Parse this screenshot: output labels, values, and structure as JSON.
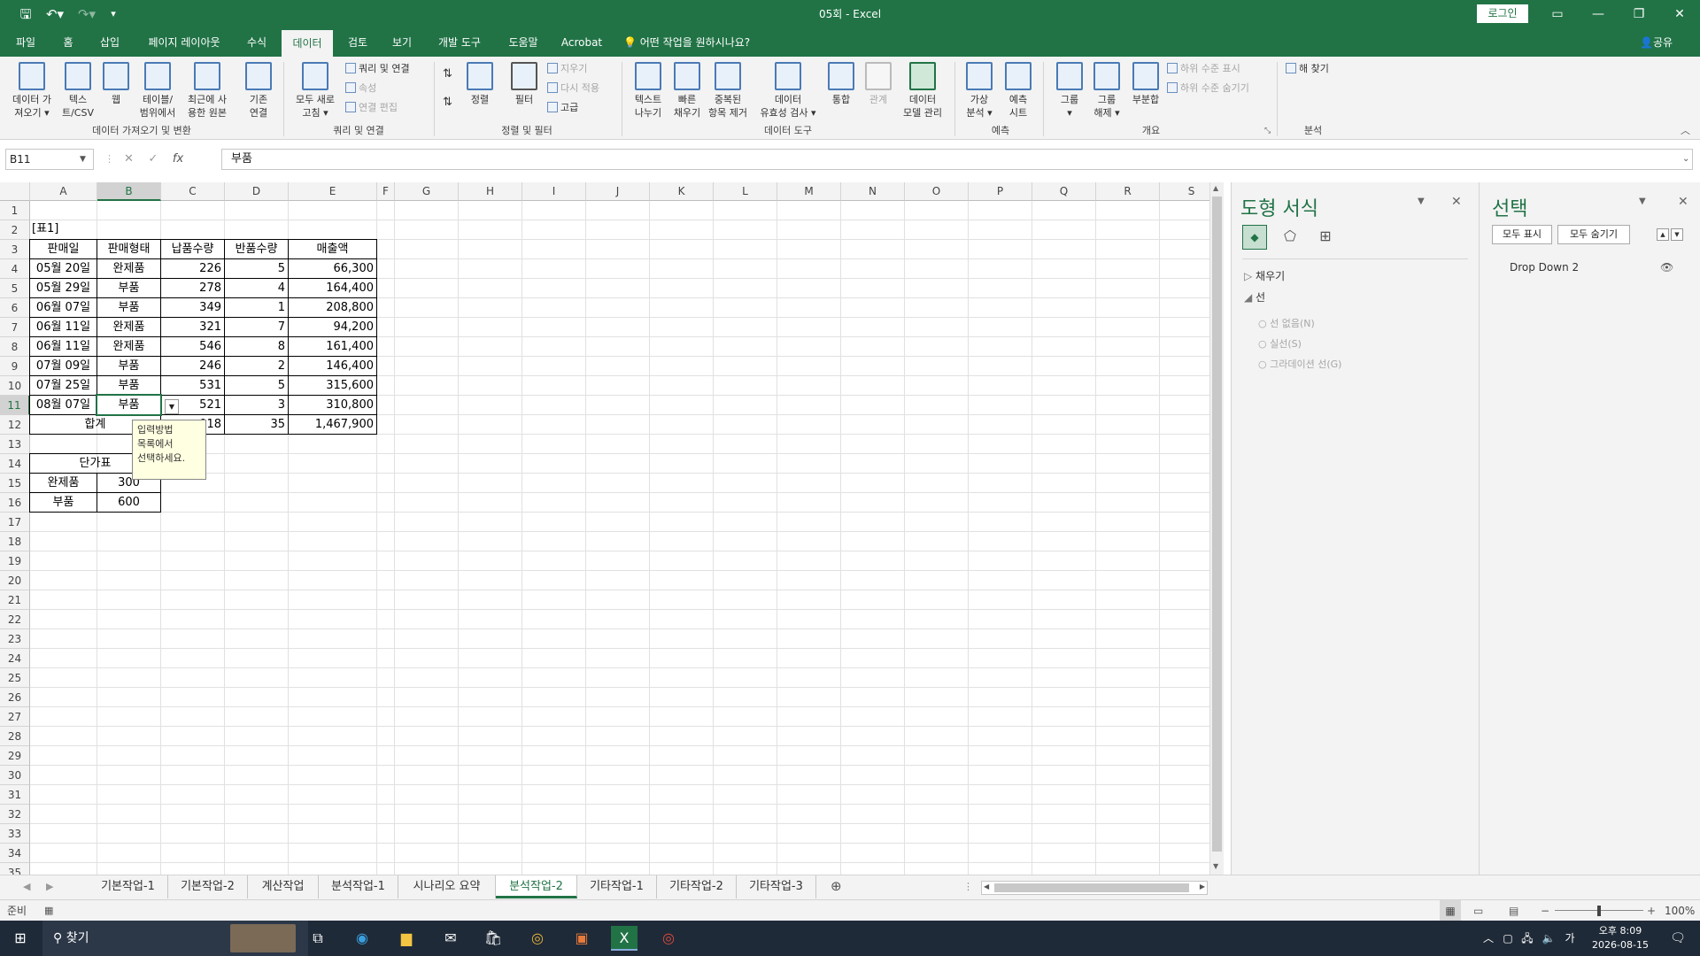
{
  "window": {
    "title": "05회 - Excel",
    "login_label": "로그인",
    "share_label": "공유"
  },
  "ribbon_tabs": [
    "파일",
    "홈",
    "삽입",
    "페이지 레이아웃",
    "수식",
    "데이터",
    "검토",
    "보기",
    "개발 도구",
    "도움말",
    "Acrobat"
  ],
  "active_tab": "데이터",
  "tell_me": "어떤 작업을 원하시나요?",
  "ribbon": {
    "get_data": {
      "line1": "데이터 가",
      "line2": "져오기 ▾"
    },
    "text_csv": {
      "line1": "텍스",
      "line2": "트/CSV"
    },
    "web": {
      "line1": "웹"
    },
    "table_range": {
      "line1": "테이블/",
      "line2": "범위에서"
    },
    "recent_sources": {
      "line1": "최근에 사",
      "line2": "용한 원본"
    },
    "existing": {
      "line1": "기존",
      "line2": "연결"
    },
    "group_get": "데이터 가져오기 및 변환",
    "refresh_all": {
      "line1": "모두 새로",
      "line2": "고침 ▾"
    },
    "queries_connections": "쿼리 및 연결",
    "properties": "속성",
    "edit_links": "연결 편집",
    "group_queries": "쿼리 및 연결",
    "sort": "정렬",
    "filter": "필터",
    "clear": "지우기",
    "reapply": "다시 적용",
    "advanced": "고급",
    "group_sort": "정렬 및 필터",
    "text_to_columns": {
      "line1": "텍스트",
      "line2": "나누기"
    },
    "flash_fill": {
      "line1": "빠른",
      "line2": "채우기"
    },
    "remove_dup": {
      "line1": "중복된",
      "line2": "항목 제거"
    },
    "validation": {
      "line1": "데이터",
      "line2": "유효성 검사 ▾"
    },
    "consolidate": {
      "line1": "통합"
    },
    "relationships": {
      "line1": "관계"
    },
    "data_model": {
      "line1": "데이터",
      "line2": "모델 관리"
    },
    "group_tools": "데이터 도구",
    "what_if": {
      "line1": "가상",
      "line2": "분석 ▾"
    },
    "forecast_sheet": {
      "line1": "예측",
      "line2": "시트"
    },
    "group_forecast": "예측",
    "group_btn": {
      "line1": "그룹",
      "line2": "▾"
    },
    "ungroup": {
      "line1": "그룹",
      "line2": "해제 ▾"
    },
    "subtotal": {
      "line1": "부분합"
    },
    "show_detail": "하위 수준 표시",
    "hide_detail": "하위 수준 숨기기",
    "group_outline": "개요",
    "solver": "해 찾기",
    "group_analysis": "분석"
  },
  "formula_bar": {
    "name_box": "B11",
    "formula": "부품"
  },
  "columns": [
    "A",
    "B",
    "C",
    "D",
    "E",
    "F",
    "G",
    "H",
    "I",
    "J",
    "K",
    "L",
    "M",
    "N",
    "O",
    "P",
    "Q",
    "R",
    "S"
  ],
  "rows": [
    "1",
    "2",
    "3",
    "4",
    "5",
    "6",
    "7",
    "8",
    "9",
    "10",
    "11",
    "12",
    "13",
    "14",
    "15",
    "16",
    "17",
    "18",
    "19",
    "20",
    "21",
    "22",
    "23",
    "24",
    "25",
    "26",
    "27",
    "28",
    "29",
    "30",
    "31",
    "32",
    "33",
    "34",
    "35"
  ],
  "sheet": {
    "table_label": "[표1]",
    "headers": [
      "판매일",
      "판매형태",
      "납품수량",
      "반품수량",
      "매출액"
    ],
    "data": [
      [
        "05월 20일",
        "완제품",
        "226",
        "5",
        "66,300"
      ],
      [
        "05월 29일",
        "부품",
        "278",
        "4",
        "164,400"
      ],
      [
        "06월 07일",
        "부품",
        "349",
        "1",
        "208,800"
      ],
      [
        "06월 11일",
        "완제품",
        "321",
        "7",
        "94,200"
      ],
      [
        "06월 11일",
        "완제품",
        "546",
        "8",
        "161,400"
      ],
      [
        "07월 09일",
        "부품",
        "246",
        "2",
        "146,400"
      ],
      [
        "07월 25일",
        "부품",
        "531",
        "5",
        "315,600"
      ],
      [
        "08월 07일",
        "부품",
        "521",
        "3",
        "310,800"
      ]
    ],
    "total_label": "합계",
    "total_c": "018",
    "total_d": "35",
    "total_e": "1,467,900",
    "price_title": "단가표",
    "price_rows": [
      [
        "완제품",
        "300"
      ],
      [
        "부품",
        "600"
      ]
    ]
  },
  "tooltip": {
    "line1": "입력방법",
    "line2": "목록에서",
    "line3": "선택하세요."
  },
  "format_pane": {
    "title": "도형 서식",
    "fill_label": "채우기",
    "line_label": "선",
    "options": [
      "선 없음(N)",
      "실선(S)",
      "그라데이션 선(G)"
    ]
  },
  "selection_pane": {
    "title": "선택",
    "show_all": "모두 표시",
    "hide_all": "모두 숨기기",
    "items": [
      "Drop Down 2"
    ]
  },
  "sheet_tabs": [
    "기본작업-1",
    "기본작업-2",
    "계산작업",
    "분석작업-1",
    "시나리오 요약",
    "분석작업-2",
    "기타작업-1",
    "기타작업-2",
    "기타작업-3"
  ],
  "active_sheet": "분석작업-2",
  "status": {
    "ready": "준비",
    "zoom": "100%"
  },
  "taskbar": {
    "search": "찾기",
    "time": "오후 8:09",
    "date": "2026-08-15",
    "ime": "가"
  }
}
